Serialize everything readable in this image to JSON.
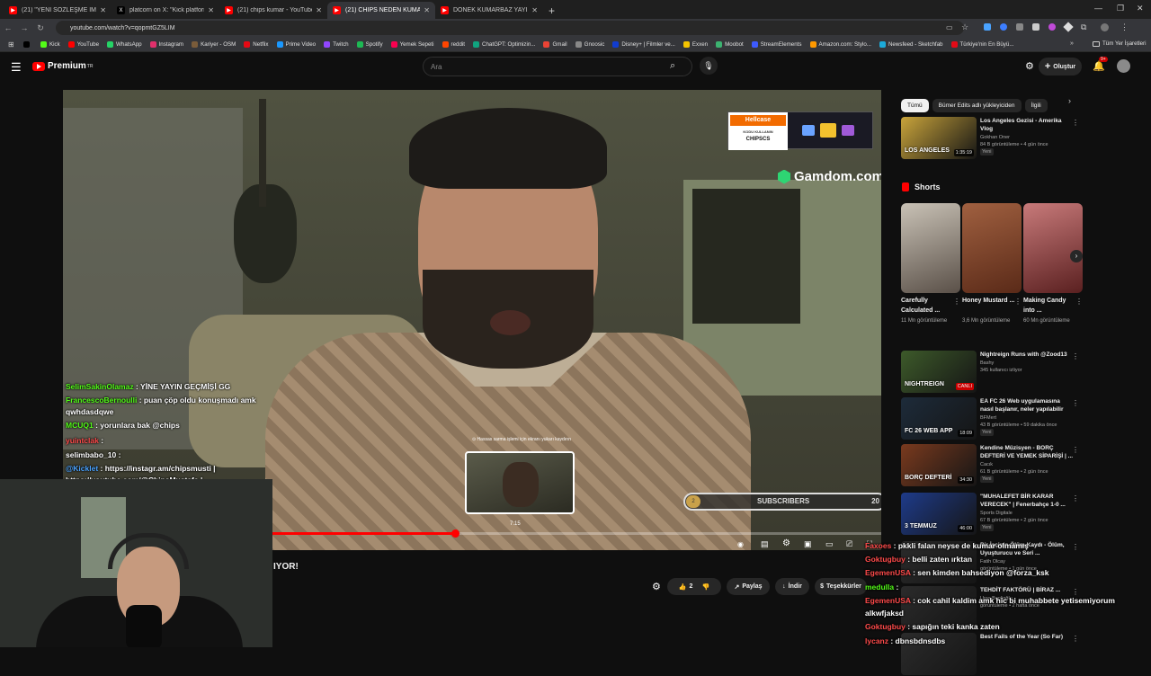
{
  "browser": {
    "tabs": [
      {
        "title": "(21) \"YENİ SÖZLEŞME İMZALAN",
        "icon": "youtube-icon",
        "color": "#ff0000"
      },
      {
        "title": "platcorn on X: \"Kick platformun",
        "icon": "x-icon",
        "color": "#000000"
      },
      {
        "title": "(21) chips kumar - YouTube",
        "icon": "youtube-icon",
        "color": "#ff0000"
      },
      {
        "title": "(21) CHİPS NEDEN KUMAR",
        "icon": "youtube-icon",
        "color": "#ff0000"
      },
      {
        "title": "DÖNEK KUMARBAZ YAYINCI -",
        "icon": "youtube-icon",
        "color": "#ff0000"
      }
    ],
    "url": "youtube.com/watch?v=qopmtGZ5LIM",
    "bookmarks": [
      {
        "label": "",
        "color": "#000000"
      },
      {
        "label": "Kick",
        "color": "#53fc18"
      },
      {
        "label": "YouTube",
        "color": "#ff0000"
      },
      {
        "label": "WhatsApp",
        "color": "#25d366"
      },
      {
        "label": "Instagram",
        "color": "#e1306c"
      },
      {
        "label": "Kariyer - OSM",
        "color": "#7a5c3a"
      },
      {
        "label": "Netflix",
        "color": "#e50914"
      },
      {
        "label": "Prime Video",
        "color": "#1a98ff"
      },
      {
        "label": "Twitch",
        "color": "#9146ff"
      },
      {
        "label": "Spotify",
        "color": "#1db954"
      },
      {
        "label": "Yemek Sepeti",
        "color": "#fa0050"
      },
      {
        "label": "reddit",
        "color": "#ff4500"
      },
      {
        "label": "ChatGPT: Optimizin...",
        "color": "#10a37f"
      },
      {
        "label": "Gmail",
        "color": "#ea4335"
      },
      {
        "label": "Gnoosic",
        "color": "#888888"
      },
      {
        "label": "Disney+ | Filmler ve...",
        "color": "#113ccf"
      },
      {
        "label": "Exxen",
        "color": "#f5c400"
      },
      {
        "label": "Moobot",
        "color": "#3cb371"
      },
      {
        "label": "StreamElements",
        "color": "#3d5afe"
      },
      {
        "label": "Amazon.com: Stylo...",
        "color": "#ff9900"
      },
      {
        "label": "Newsfeed - Sketchfab",
        "color": "#1caad9"
      },
      {
        "label": "Türkiye'nin En Büyü...",
        "color": "#e30a17"
      }
    ],
    "all_bookmarks": "Tüm Yer İşaretleri"
  },
  "youtube": {
    "logo_text": "Premium",
    "logo_badge": "TR",
    "search_placeholder": "Ara",
    "create_label": "Oluştur",
    "notif_count": "9+",
    "chips": [
      "Tümü",
      "Bümer Edits adlı yükleyiciden",
      "İlgili"
    ],
    "shorts_heading": "Shorts",
    "shorts": [
      {
        "title": "Carefully Calculated ...",
        "views": "11 Mn görüntüleme"
      },
      {
        "title": "Honey Mustard ...",
        "views": "3,6 Mn görüntüleme"
      },
      {
        "title": "Making Candy into ...",
        "views": "60 Mn görüntüleme"
      }
    ],
    "related": [
      {
        "title": "Los Angeles Gezisi - Amerika Vlog",
        "channel": "Gokhan Oner",
        "meta": "84 B görüntüleme • 4 gün önce",
        "badge": "Yeni",
        "duration": "1:35:19",
        "thumb_text": "LOS ANGELES",
        "thumb_color": "#c9a43b"
      },
      {
        "title": "Nightreign Runs with @Zood13",
        "channel": "Bashy",
        "meta": "345 kullanıcı izliyor",
        "badge": "",
        "duration": "CANLI",
        "thumb_text": "NIGHTREIGN",
        "thumb_color": "#3d5a2a"
      },
      {
        "title": "EA FC 26 Web uygulamasına nasıl başlanır, neler yapılabilir",
        "channel": "BFMert",
        "meta": "43 B görüntüleme • 59 dakika önce",
        "badge": "Yeni",
        "duration": "18:09",
        "thumb_text": "FC 26 WEB APP",
        "thumb_color": "#1d2b3a"
      },
      {
        "title": "Kendine Müzisyen - BORÇ DEFTERİ VE YEMEK SİPARİŞİ | ...",
        "channel": "Cacık",
        "meta": "61 B görüntüleme • 2 gün önce",
        "badge": "Yeni",
        "duration": "34:30",
        "thumb_text": "BORÇ DEFTERİ",
        "thumb_color": "#7a3a1e"
      },
      {
        "title": "\"MUHALEFET BİR KARAR VERECEK\" | Fenerbahçe 1-0 ...",
        "channel": "Sports Digitale",
        "meta": "67 B görüntüleme • 2 gün önce",
        "badge": "Yeni",
        "duration": "46:00",
        "thumb_text": "3 TEMMUZ",
        "thumb_color": "#1e3b8a"
      },
      {
        "title": "Bir İşçinin Ölüm Kaydı - Ölüm, Uyuşturucu ve Seri ...",
        "channel": "Fatih Olcay",
        "meta": "görüntüleme • 1 gün önce",
        "badge": "",
        "duration": "",
        "thumb_text": "",
        "thumb_color": "#2b2b2b"
      },
      {
        "title": "TEHDİT FAKTÖRÜ | BİRAZ ...",
        "channel": "Uras Benlioğlu",
        "meta": "görüntüleme • 2 hafta önce",
        "badge": "",
        "duration": "",
        "thumb_text": "",
        "thumb_color": "#2b2b2b"
      },
      {
        "title": "Best Fails of the Year (So Far)",
        "channel": "",
        "meta": "",
        "badge": "",
        "duration": "",
        "thumb_text": "",
        "thumb_color": "#2b2b2b"
      }
    ],
    "video_title_partial": "IYOR!",
    "actions": {
      "likes": "2",
      "share": "Paylaş",
      "download": "İndir",
      "thanks": "Teşekkürler"
    }
  },
  "video": {
    "sponsor1_brand": "Hellcase",
    "sponsor1_line1": "KODU KULLANIN",
    "sponsor1_line2": "CHIPSCS",
    "sponsor2_brand": "Gamdom.com",
    "subscribers_label": "SUBSCRIBERS",
    "subscribers_count": "20",
    "subscribers_left": "2",
    "preview_notice": "⊙ Hassas sarma işlemi için ekranı yukarı kaydırın",
    "preview_time": "7:15",
    "progress_fraction": 0.3,
    "stream_chat": [
      {
        "user": "SelimSakinOlamaz",
        "msg": " : YİNE YAYIN GEÇMİŞİ GG",
        "color": "g"
      },
      {
        "user": "FrancescoBernoulli",
        "msg": " : puan çöp oldu konuşmadı amk qwhdasdqwe",
        "color": "g"
      },
      {
        "user": "MCUQ1",
        "msg": " : yorunlara bak @chips",
        "color": "g"
      },
      {
        "user": "yuintclak",
        "msg": " : ",
        "color": "r"
      },
      {
        "user": "selimbabo_10",
        "msg": " : ",
        "color": "w"
      },
      {
        "user": "@Kicklet",
        "msg": " : https://instagr.am/chipsmusti |",
        "color": "b"
      },
      {
        "user": "",
        "msg": "https://youtube.com/@ChipsMustafa |",
        "color": "w"
      }
    ]
  },
  "overlay_chat": [
    {
      "user": "Faxoes",
      "msg": " : pkkli falan neyse de kumar olmamış",
      "color": "r"
    },
    {
      "user": "Goktugbuy",
      "msg": " : belli zaten ırktan",
      "color": "r"
    },
    {
      "user": "EgemenUSA",
      "msg": " : sen kimden bahsediyon @forza_ksk",
      "color": "r"
    },
    {
      "user": "medulla",
      "msg": " : ",
      "color": "g"
    },
    {
      "user": "EgemenUSA",
      "msg": " : cok cahil kaldim amk hic bi muhabbete yetisemiyorum alkwfjaksd",
      "color": "r"
    },
    {
      "user": "Goktugbuy",
      "msg": " : sapığın teki kanka zaten",
      "color": "r"
    },
    {
      "user": "lycanz",
      "msg": " : dbnsbdnsdbs",
      "color": "r"
    }
  ]
}
